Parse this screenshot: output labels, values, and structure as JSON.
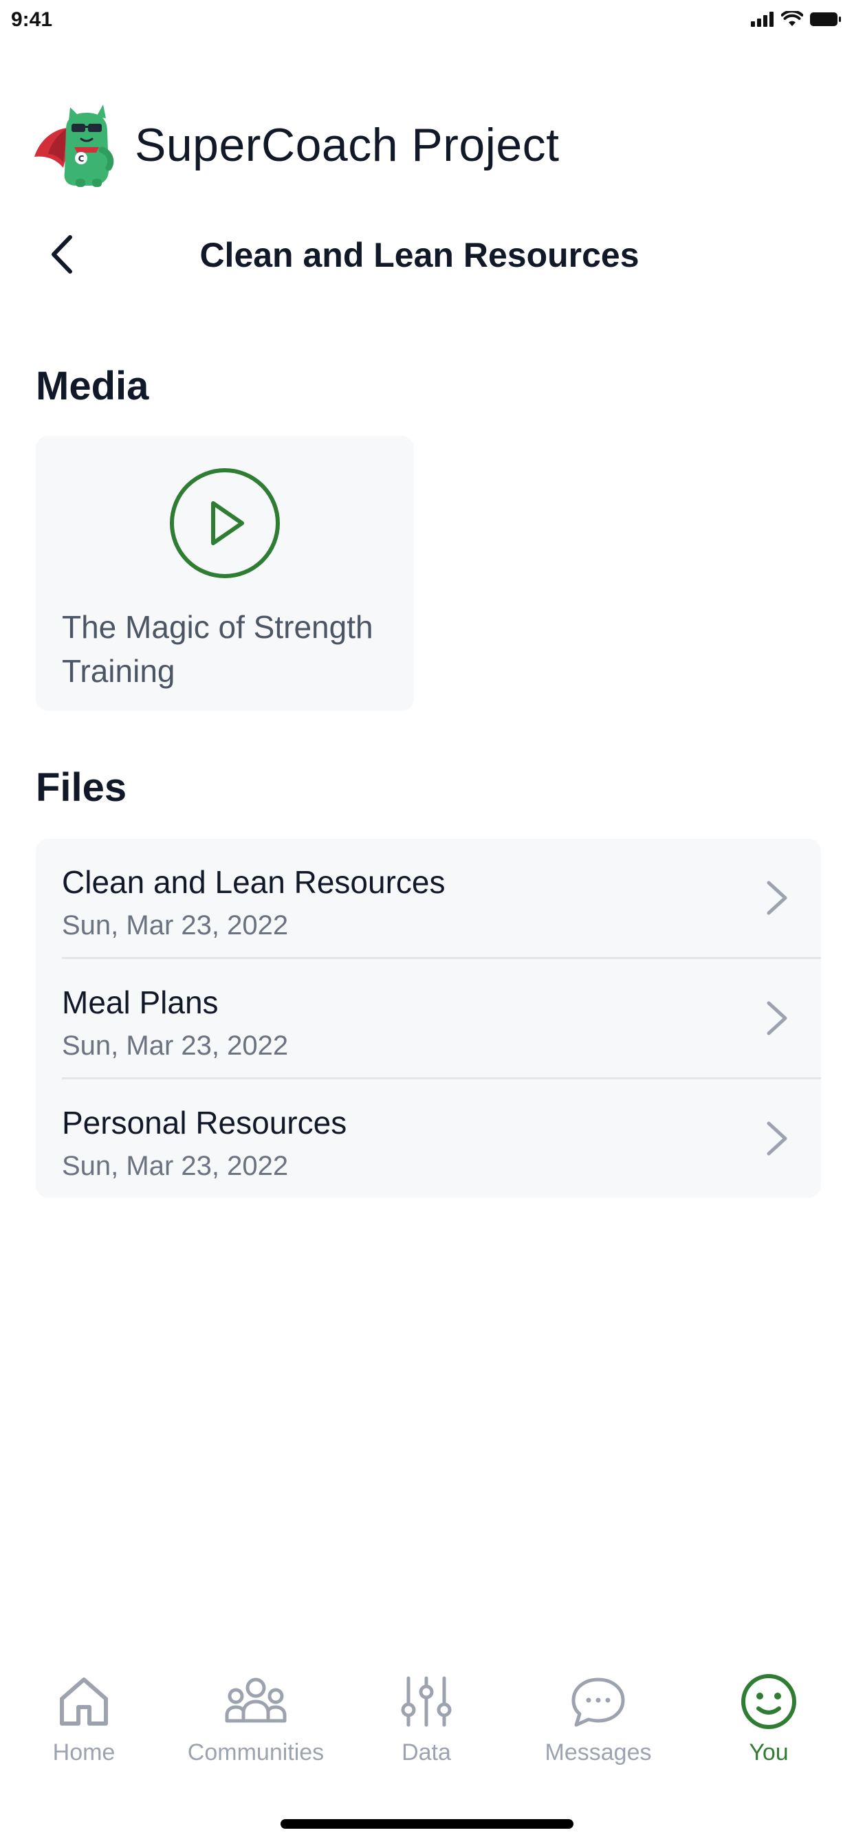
{
  "status_bar": {
    "time": "9:41"
  },
  "brand": {
    "title": "SuperCoach Project"
  },
  "header": {
    "title": "Clean and Lean Resources"
  },
  "media": {
    "section_title": "Media",
    "items": [
      {
        "title": "The Magic of Strength Training"
      }
    ]
  },
  "files": {
    "section_title": "Files",
    "items": [
      {
        "name": "Clean and Lean Resources",
        "date": "Sun, Mar 23, 2022"
      },
      {
        "name": "Meal Plans",
        "date": "Sun, Mar 23, 2022"
      },
      {
        "name": "Personal Resources",
        "date": "Sun, Mar 23, 2022"
      }
    ]
  },
  "tab_bar": {
    "tabs": [
      {
        "label": "Home",
        "icon": "home-icon",
        "active": false
      },
      {
        "label": "Communities",
        "icon": "people-icon",
        "active": false
      },
      {
        "label": "Data",
        "icon": "sliders-icon",
        "active": false
      },
      {
        "label": "Messages",
        "icon": "chat-bubble-icon",
        "active": false
      },
      {
        "label": "You",
        "icon": "smiley-icon",
        "active": true
      }
    ]
  },
  "colors": {
    "accent_green": "#2e7d32",
    "inactive_gray": "#9ca3af",
    "card_background": "#f7f8fa",
    "text_primary": "#111827"
  }
}
